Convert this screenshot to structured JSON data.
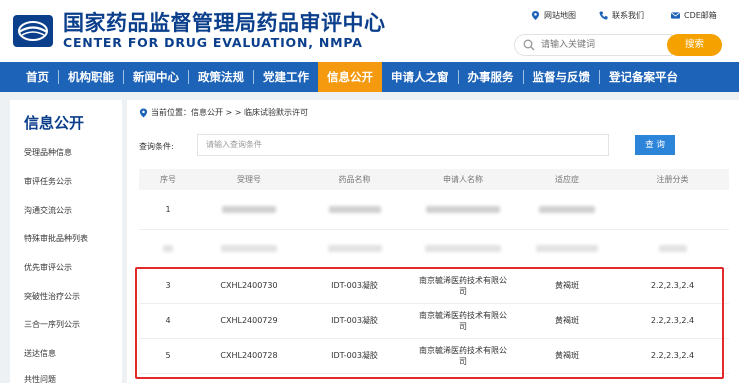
{
  "header": {
    "title_cn": "国家药品监督管理局药品审评中心",
    "title_en": "CENTER FOR DRUG EVALUATION, NMPA",
    "top_links": [
      {
        "label": "网站地图",
        "icon": "map-pin-icon"
      },
      {
        "label": "联系我们",
        "icon": "phone-icon"
      },
      {
        "label": "CDE邮箱",
        "icon": "mail-icon"
      }
    ],
    "search": {
      "placeholder": "请输入关键词",
      "button_label": "搜索"
    },
    "colors": {
      "brand": "#0b3f8c",
      "nav": "#1d63b8",
      "accent": "#f59a0f"
    }
  },
  "nav": {
    "items": [
      "首页",
      "机构职能",
      "新闻中心",
      "政策法规",
      "党建工作",
      "信息公开",
      "申请人之窗",
      "办事服务",
      "监督与反馈",
      "登记备案平台"
    ],
    "active_index": 5
  },
  "sidebar": {
    "title": "信息公开",
    "items": [
      "受理品种信息",
      "审评任务公示",
      "沟通交流公示",
      "特殊审批品种列表",
      "优先审评公示",
      "突破性治疗公示",
      "三合一序列公示",
      "送达信息",
      "共性问题"
    ]
  },
  "breadcrumb": {
    "current_label": "当前位置：",
    "path": "信息公开 > > 临床试验默示许可"
  },
  "query": {
    "label": "查询条件:",
    "placeholder": "请输入查询条件",
    "button_label": "查 询"
  },
  "table": {
    "headers": [
      "序号",
      "受理号",
      "药品名称",
      "申请人名称",
      "适应症",
      "注册分类"
    ],
    "rows": [
      {
        "no": "1",
        "redacted": true
      },
      {
        "no": "",
        "redacted": true
      },
      {
        "no": "3",
        "accept_no": "CXHL2400730",
        "drug": "IDT-003凝胶",
        "applicant_l1": "南京毓浠医药技术有限公",
        "applicant_l2": "司",
        "indication": "黄褐斑",
        "category": "2.2,2.3,2.4"
      },
      {
        "no": "4",
        "accept_no": "CXHL2400729",
        "drug": "IDT-003凝胶",
        "applicant_l1": "南京毓浠医药技术有限公",
        "applicant_l2": "司",
        "indication": "黄褐斑",
        "category": "2.2,2.3,2.4"
      },
      {
        "no": "5",
        "accept_no": "CXHL2400728",
        "drug": "IDT-003凝胶",
        "applicant_l1": "南京毓浠医药技术有限公",
        "applicant_l2": "司",
        "indication": "黄褐斑",
        "category": "2.2,2.3,2.4"
      }
    ]
  }
}
